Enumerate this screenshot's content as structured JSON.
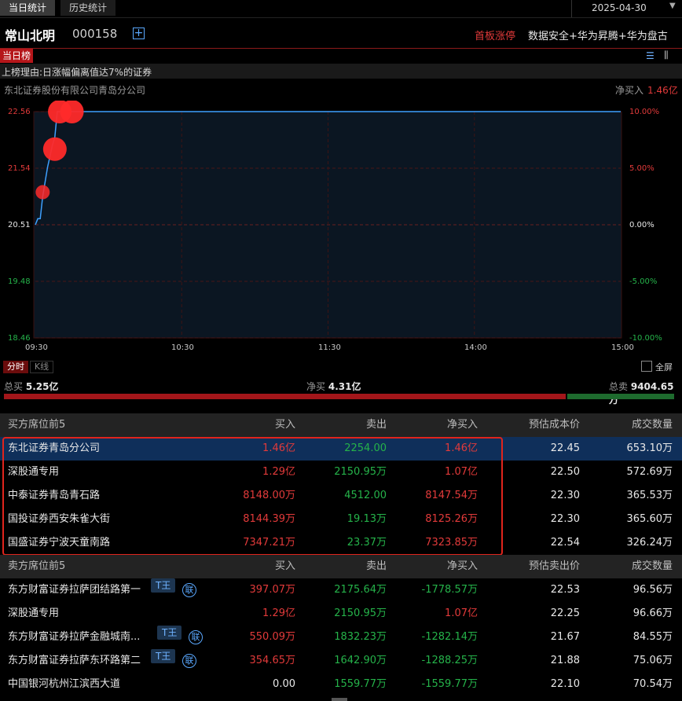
{
  "tabs": {
    "today": "当日统计",
    "history": "历史统计"
  },
  "date": "2025-04-30",
  "stock": {
    "name": "常山北明",
    "code": "000158"
  },
  "status": {
    "limit_up": "首板涨停",
    "concepts": "数据安全+华为昇腾+华为盘古"
  },
  "board": {
    "label": "当日榜",
    "reason": "上榜理由:日涨幅偏离值达7%的证券"
  },
  "chart_header": {
    "broker": "东北证券股份有限公司青岛分公司",
    "net_label": "净买入",
    "net_value": "1.46亿"
  },
  "chart_data": {
    "type": "line",
    "x_ticks": [
      "09:30",
      "10:30",
      "11:30",
      "14:00",
      "15:00"
    ],
    "y_ticks": [
      "22.56",
      "21.54",
      "20.51",
      "19.48",
      "18.46"
    ],
    "y2_ticks": [
      "10.00%",
      "5.00%",
      "0.00%",
      "-5.00%",
      "-10.00%"
    ],
    "ylim": [
      18.46,
      22.56
    ],
    "series": [
      {
        "values": [
          [
            "09:30",
            20.51
          ],
          [
            "09:31",
            20.62
          ],
          [
            "09:32",
            20.62
          ],
          [
            "09:33",
            21.02
          ],
          [
            "09:35",
            21.55
          ],
          [
            "09:37",
            21.95
          ],
          [
            "09:38",
            22.1
          ],
          [
            "09:39",
            22.56
          ],
          [
            "15:00",
            22.56
          ]
        ]
      }
    ],
    "bubbles": [
      {
        "time": "09:33",
        "price": 21.1,
        "size": "small"
      },
      {
        "time": "09:38",
        "price": 21.88,
        "size": "large"
      },
      {
        "time": "09:40",
        "price": 22.56,
        "size": "large"
      },
      {
        "time": "09:45",
        "price": 22.56,
        "size": "large"
      }
    ]
  },
  "chart_tabs": {
    "fenshi": "分时",
    "kline": "K线",
    "fullscreen": "全屏"
  },
  "totals": {
    "buy_label": "总买",
    "buy_value": "5.25亿",
    "net_label": "净买",
    "net_value": "4.31亿",
    "sell_label": "总卖",
    "sell_value": "9404.65万",
    "buy_ratio": 0.84
  },
  "buy_table": {
    "headers": [
      "买方席位前5",
      "买入",
      "卖出",
      "净买入",
      "预估成本价",
      "成交数量"
    ],
    "rows": [
      {
        "name": "东北证券青岛分公司",
        "buy": "1.46亿",
        "sell": "2254.00",
        "net": "1.46亿",
        "price": "22.45",
        "vol": "653.10万"
      },
      {
        "name": "深股通专用",
        "buy": "1.29亿",
        "sell": "2150.95万",
        "net": "1.07亿",
        "price": "22.50",
        "vol": "572.69万"
      },
      {
        "name": "中泰证券青岛青石路",
        "buy": "8148.00万",
        "sell": "4512.00",
        "net": "8147.54万",
        "price": "22.30",
        "vol": "365.53万"
      },
      {
        "name": "国投证券西安朱雀大街",
        "buy": "8144.39万",
        "sell": "19.13万",
        "net": "8125.26万",
        "price": "22.30",
        "vol": "365.60万"
      },
      {
        "name": "国盛证券宁波天童南路",
        "buy": "7347.21万",
        "sell": "23.37万",
        "net": "7323.85万",
        "price": "22.54",
        "vol": "326.24万"
      }
    ]
  },
  "sell_table": {
    "headers": [
      "卖方席位前5",
      "买入",
      "卖出",
      "净买入",
      "预估卖出价",
      "成交数量"
    ],
    "tag_t": "T王",
    "tag_lian": "联",
    "rows": [
      {
        "name": "东方财富证券拉萨团结路第一",
        "buy": "397.07万",
        "sell": "2175.64万",
        "net": "-1778.57万",
        "price": "22.53",
        "vol": "96.56万"
      },
      {
        "name": "深股通专用",
        "buy": "1.29亿",
        "sell": "2150.95万",
        "net": "1.07亿",
        "price": "22.25",
        "vol": "96.66万"
      },
      {
        "name": "东方财富证券拉萨金融城南...",
        "buy": "550.09万",
        "sell": "1832.23万",
        "net": "-1282.14万",
        "price": "21.67",
        "vol": "84.55万"
      },
      {
        "name": "东方财富证券拉萨东环路第二",
        "buy": "354.65万",
        "sell": "1642.90万",
        "net": "-1288.25万",
        "price": "21.88",
        "vol": "75.06万"
      },
      {
        "name": "中国银河杭州江滨西大道",
        "buy": "0.00",
        "sell": "1559.77万",
        "net": "-1559.77万",
        "price": "22.10",
        "vol": "70.54万"
      }
    ]
  }
}
